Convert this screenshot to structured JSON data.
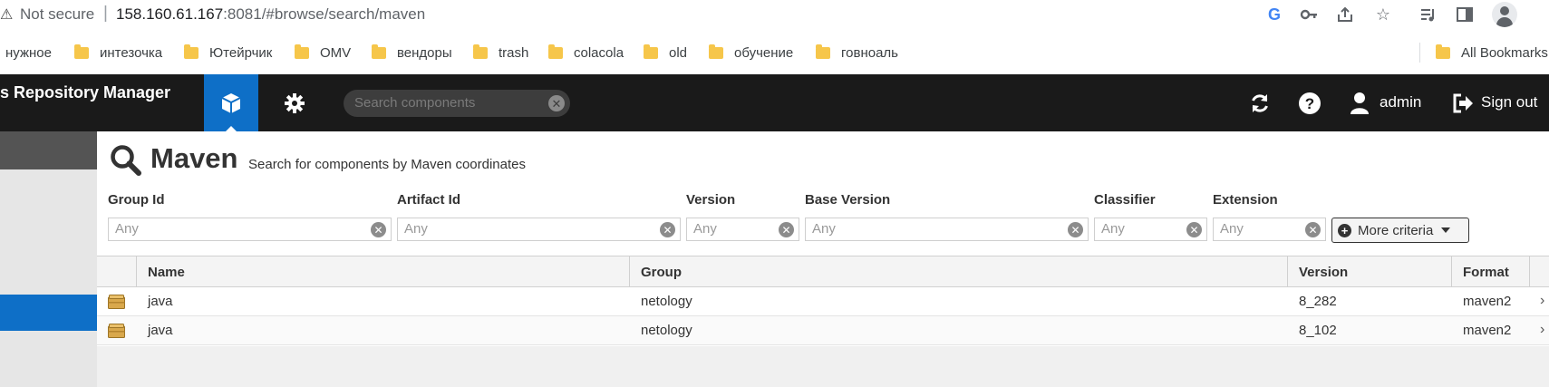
{
  "browser": {
    "security_label": "Not secure",
    "url_host": "158.160.61.167",
    "url_rest": ":8081/#browse/search/maven",
    "toolbar_icons": [
      "google-lens-icon",
      "key-icon",
      "share-icon",
      "star-icon",
      "reading-list-icon",
      "side-panel-icon",
      "profile-avatar-icon"
    ]
  },
  "bookmarks": {
    "items": [
      {
        "label": "нужное",
        "folder": false
      },
      {
        "label": "интезочка",
        "folder": true
      },
      {
        "label": "Ютейрчик",
        "folder": true
      },
      {
        "label": "OMV",
        "folder": true
      },
      {
        "label": "вендоры",
        "folder": true
      },
      {
        "label": "trash",
        "folder": true
      },
      {
        "label": "colacola",
        "folder": true
      },
      {
        "label": "old",
        "folder": true
      },
      {
        "label": "обучение",
        "folder": true
      },
      {
        "label": "говноаль",
        "folder": true
      }
    ],
    "all_bookmarks": "All Bookmarks"
  },
  "header": {
    "brand": "s Repository Manager",
    "search_placeholder": "Search components",
    "user": "admin",
    "sign_out": "Sign out"
  },
  "main": {
    "title": "Maven",
    "subtitle": "Search for components by Maven coordinates",
    "criteria": [
      {
        "label": "Group Id",
        "placeholder": "Any"
      },
      {
        "label": "Artifact Id",
        "placeholder": "Any"
      },
      {
        "label": "Version",
        "placeholder": "Any"
      },
      {
        "label": "Base Version",
        "placeholder": "Any"
      },
      {
        "label": "Classifier",
        "placeholder": "Any"
      },
      {
        "label": "Extension",
        "placeholder": "Any"
      }
    ],
    "more_criteria": "More criteria"
  },
  "grid": {
    "columns": [
      "Name",
      "Group",
      "Version",
      "Format"
    ],
    "rows": [
      {
        "name": "java",
        "group": "netology",
        "version": "8_282",
        "format": "maven2"
      },
      {
        "name": "java",
        "group": "netology",
        "version": "8_102",
        "format": "maven2"
      }
    ]
  },
  "colors": {
    "header_bg": "#1a1a1a",
    "accent_blue": "#0e6fc7",
    "sidebar_bg": "#e6e6e6"
  }
}
